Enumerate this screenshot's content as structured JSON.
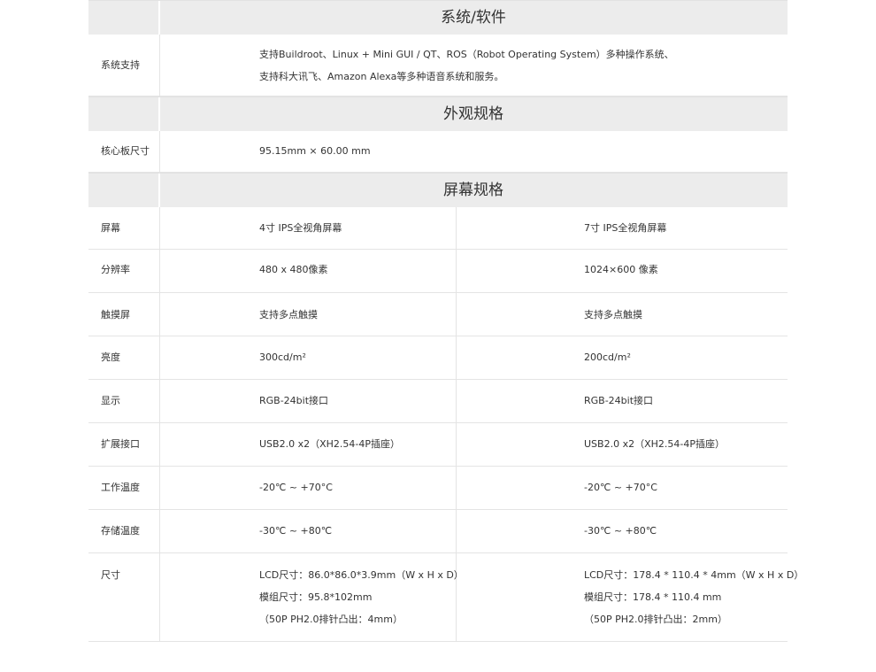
{
  "sections": {
    "system": {
      "title": "系统/软件"
    },
    "appearance": {
      "title": "外观规格"
    },
    "screen": {
      "title": "屏幕规格"
    }
  },
  "system_support": {
    "label": "系统支持",
    "lines": [
      "支持Buildroot、Linux + Mini GUI / QT、ROS（Robot Operating System）多种操作系统、",
      "支持科大讯飞、Amazon Alexa等多种语音系统和服务。"
    ]
  },
  "board_size": {
    "label": "核心板尺寸",
    "value": "95.15mm × 60.00 mm"
  },
  "screen_rows": [
    {
      "label": "屏幕",
      "col1": [
        "4寸 IPS全视角屏幕"
      ],
      "col2": [
        "7寸 IPS全视角屏幕"
      ]
    },
    {
      "label": "分辨率",
      "col1": [
        "480 x 480像素"
      ],
      "col2": [
        "1024×600 像素"
      ]
    },
    {
      "label": "触摸屏",
      "col1": [
        "支持多点触摸"
      ],
      "col2": [
        "支持多点触摸"
      ]
    },
    {
      "label": "亮度",
      "col1": [
        "300cd/m²"
      ],
      "col2": [
        "200cd/m²"
      ]
    },
    {
      "label": "显示",
      "col1": [
        "RGB-24bit接口"
      ],
      "col2": [
        "RGB-24bit接口"
      ]
    },
    {
      "label": "扩展接口",
      "col1": [
        "USB2.0 x2（XH2.54-4P插座）"
      ],
      "col2": [
        "USB2.0 x2（XH2.54-4P插座）"
      ]
    },
    {
      "label": "工作温度",
      "col1": [
        "-20℃ ~ +70°C"
      ],
      "col2": [
        "-20℃ ~ +70°C"
      ]
    },
    {
      "label": "存储温度",
      "col1": [
        "-30℃ ~ +80℃"
      ],
      "col2": [
        "-30℃ ~ +80℃"
      ]
    },
    {
      "label": "尺寸",
      "col1": [
        "LCD尺寸：86.0*86.0*3.9mm（W x H x D）",
        "模组尺寸：95.8*102mm",
        "（50P PH2.0排针凸出：4mm）"
      ],
      "col2": [
        "LCD尺寸：178.4 * 110.4 * 4mm（W x H x D）",
        "模组尺寸：178.4 * 110.4 mm",
        "（50P PH2.0排针凸出：2mm）"
      ]
    }
  ]
}
